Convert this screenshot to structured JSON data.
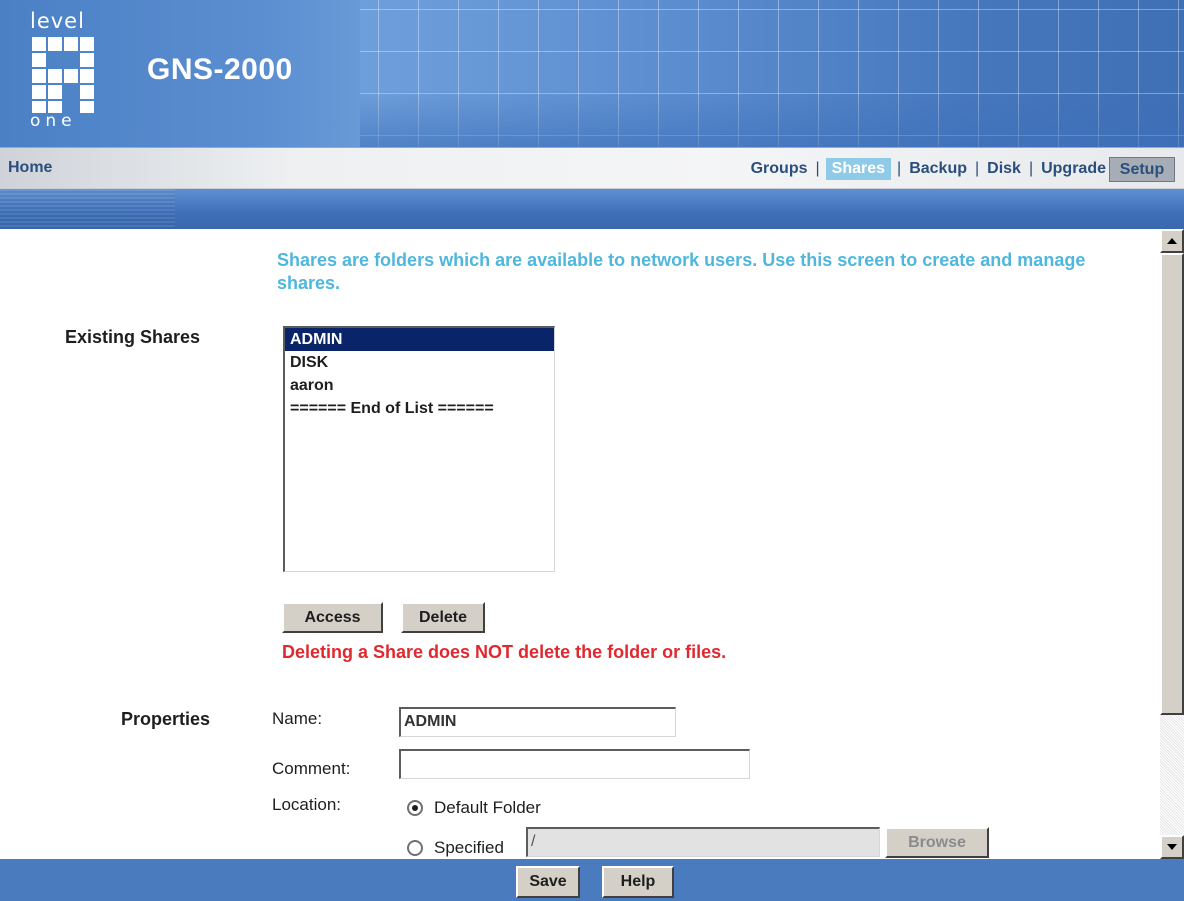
{
  "brand": {
    "logo_top": "level",
    "logo_bottom": "one",
    "product": "GNS-2000"
  },
  "nav": {
    "home": "Home",
    "links": [
      "Groups",
      "Shares",
      "Backup",
      "Disk",
      "Upgrade"
    ],
    "separator": "|",
    "active": "Shares",
    "setup": "Setup"
  },
  "intro": "Shares are folders which are available to network users. Use this screen to create and manage shares.",
  "existing": {
    "label": "Existing Shares",
    "items": [
      "ADMIN",
      "DISK",
      "aaron",
      "====== End of List ======"
    ],
    "selected": "ADMIN",
    "access_button": "Access",
    "delete_button": "Delete",
    "warning": "Deleting a Share does NOT delete the folder or files."
  },
  "properties": {
    "label": "Properties",
    "name_label": "Name:",
    "name_value": "ADMIN",
    "comment_label": "Comment:",
    "comment_value": "",
    "location_label": "Location:",
    "default_folder": "Default Folder",
    "specified": "Specified",
    "specified_value": "/",
    "browse_button": "Browse",
    "location_selected": "Default Folder"
  },
  "footer": {
    "save": "Save",
    "help": "Help"
  },
  "colors": {
    "banner_blue": "#4a7bbf",
    "intro_text": "#4fb7de",
    "warning_text": "#e0292f",
    "selection": "#0a246a",
    "active_tab": "#8fcbe8"
  }
}
